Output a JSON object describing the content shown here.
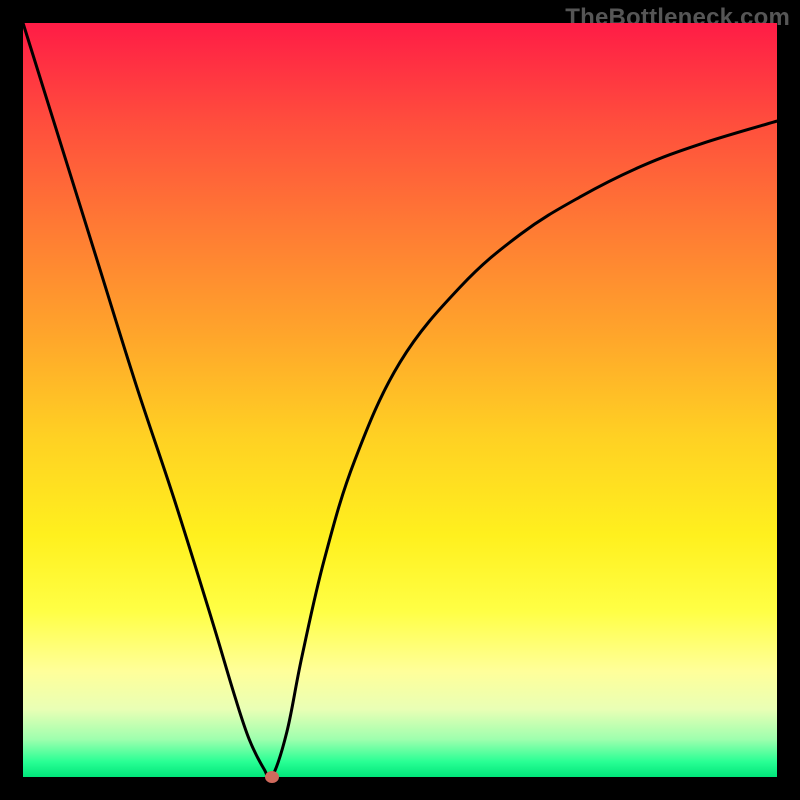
{
  "watermark": "TheBottleneck.com",
  "colors": {
    "page_bg": "#000000",
    "gradient_top": "#ff1c46",
    "gradient_bottom": "#00e57a",
    "curve": "#000000",
    "marker": "#d06a5d",
    "watermark": "#565656"
  },
  "chart_data": {
    "type": "line",
    "title": "",
    "xlabel": "",
    "ylabel": "",
    "legend": [],
    "xlim": [
      0,
      100
    ],
    "ylim": [
      0,
      100
    ],
    "grid": false,
    "series": [
      {
        "name": "left-branch",
        "x": [
          0,
          5,
          10,
          15,
          20,
          25,
          28,
          30,
          32,
          33
        ],
        "values": [
          100,
          84,
          68,
          52,
          37,
          21,
          11,
          5,
          1,
          0
        ]
      },
      {
        "name": "right-branch",
        "x": [
          33,
          35,
          37,
          40,
          44,
          50,
          58,
          66,
          74,
          82,
          90,
          100
        ],
        "values": [
          0,
          6,
          16,
          29,
          42,
          55,
          65,
          72,
          77,
          81,
          84,
          87
        ]
      }
    ],
    "markers": [
      {
        "name": "minimum-point",
        "x": 33,
        "y": 0
      }
    ],
    "annotations": []
  }
}
